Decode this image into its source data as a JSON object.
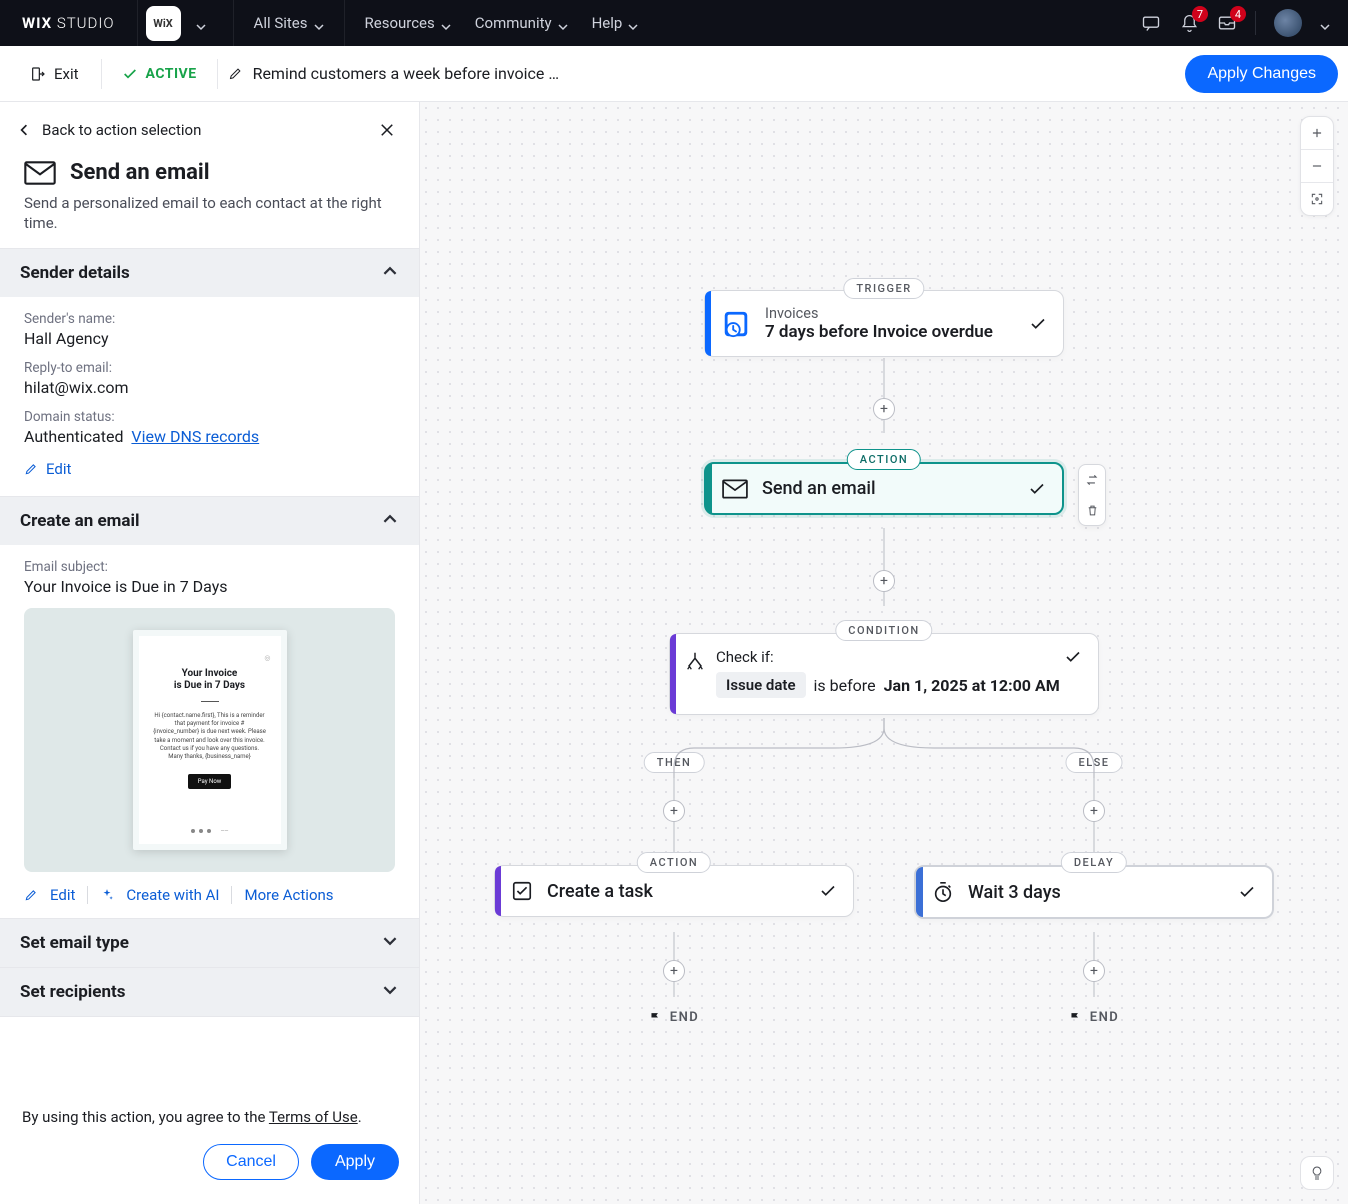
{
  "topnav": {
    "logo_a": "WIX",
    "logo_b": "STUDIO",
    "site_chip": "WiX",
    "items": [
      "All Sites",
      "Resources",
      "Community",
      "Help"
    ],
    "notif_count": "7",
    "inbox_count": "4"
  },
  "actionbar": {
    "exit": "Exit",
    "status": "ACTIVE",
    "automation_name": "Remind customers a week before invoice …",
    "apply_changes": "Apply Changes"
  },
  "panel": {
    "back": "Back to action selection",
    "title": "Send an email",
    "description": "Send a personalized email to each contact at the right time.",
    "sender_details": {
      "heading": "Sender details",
      "name_label": "Sender's name:",
      "name_value": "Hall Agency",
      "reply_label": "Reply-to email:",
      "reply_value": "hilat@wix.com",
      "domain_label": "Domain status:",
      "domain_value": "Authenticated",
      "view_dns": "View DNS records",
      "edit": "Edit"
    },
    "create_email": {
      "heading": "Create an email",
      "subject_label": "Email subject:",
      "subject_value": "Your Invoice is Due in 7 Days",
      "preview_title_a": "Your Invoice",
      "preview_title_b": "is Due in 7 Days",
      "preview_body": "Hi {contact.name.first}, This is a reminder that payment for invoice #{invoice_number} is due next week. Please take a moment and look over this invoice. Contact us if you have any questions. Many thanks, {business_name}",
      "preview_cta": "Pay Now",
      "edit": "Edit",
      "create_with_ai": "Create with AI",
      "more_actions": "More Actions"
    },
    "set_email_type": "Set email type",
    "set_recipients": "Set recipients",
    "terms_prefix": "By using this action, you agree to the ",
    "terms_link": "Terms of Use",
    "cancel": "Cancel",
    "apply": "Apply"
  },
  "flow": {
    "labels": {
      "trigger": "TRIGGER",
      "action": "ACTION",
      "condition": "CONDITION",
      "then": "THEN",
      "else": "ELSE",
      "delay": "DELAY",
      "end": "END"
    },
    "trigger": {
      "category": "Invoices",
      "text": "7 days before Invoice overdue"
    },
    "action_email": "Send an email",
    "condition": {
      "check_if": "Check if:",
      "field": "Issue date",
      "op": "is before",
      "value": "Jan 1, 2025 at 12:00 AM"
    },
    "task": "Create a task",
    "delay": "Wait 3 days"
  }
}
